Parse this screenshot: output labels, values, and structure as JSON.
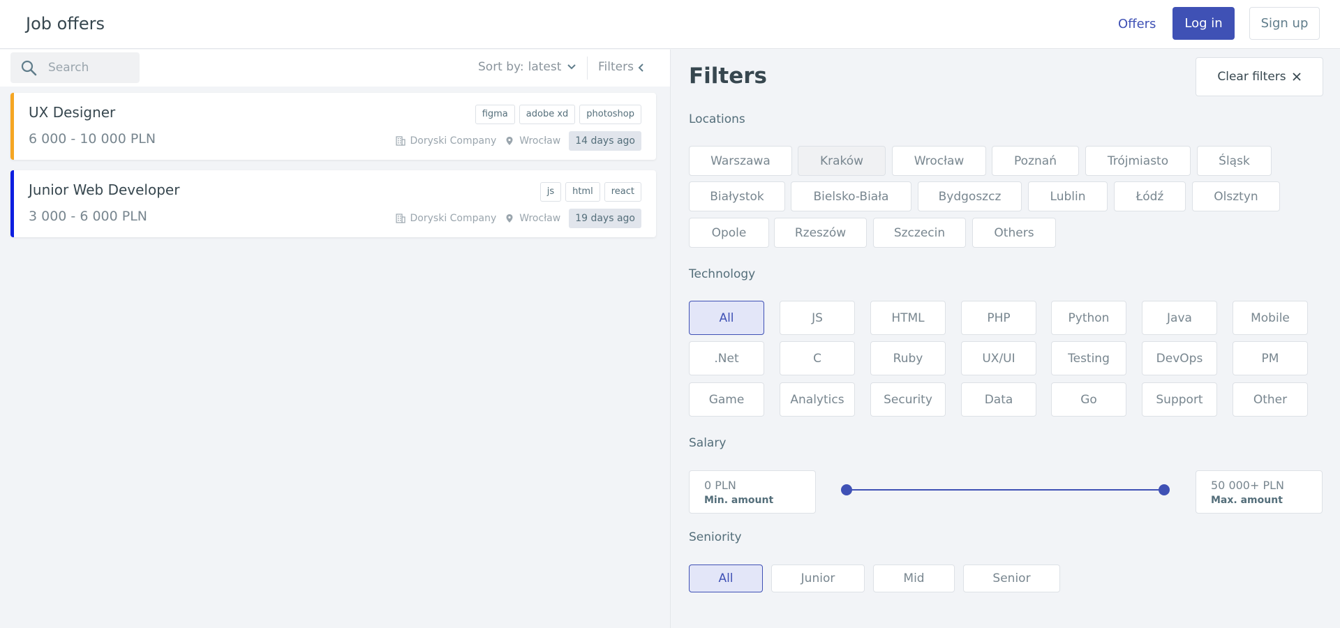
{
  "header": {
    "title": "Job offers",
    "nav_offers": "Offers",
    "login": "Log in",
    "signup": "Sign up",
    "accent": "#3f51b5"
  },
  "toolbar": {
    "search_placeholder": "Search",
    "sort_label": "Sort by:",
    "sort_value": "latest",
    "filters_label": "Filters"
  },
  "jobs": [
    {
      "title": "UX Designer",
      "salary": "6 000 - 10 000 PLN",
      "tags": [
        "figma",
        "adobe xd",
        "photoshop"
      ],
      "company": "Doryski Company",
      "city": "Wrocław",
      "age": "14 days ago",
      "accent": "#f5a623"
    },
    {
      "title": "Junior Web Developer",
      "salary": "3 000 - 6 000 PLN",
      "tags": [
        "js",
        "html",
        "react"
      ],
      "company": "Doryski Company",
      "city": "Wrocław",
      "age": "19 days ago",
      "accent": "#0d1ee0"
    }
  ],
  "filters": {
    "title": "Filters",
    "clear": "Clear filters",
    "locations_label": "Locations",
    "locations": [
      "Warszawa",
      "Kraków",
      "Wrocław",
      "Poznań",
      "Trójmiasto",
      "Śląsk",
      "Białystok",
      "Bielsko-Biała",
      "Bydgoszcz",
      "Lublin",
      "Łódź",
      "Olsztyn",
      "Opole",
      "Rzeszów",
      "Szczecin",
      "Others"
    ],
    "technology_label": "Technology",
    "technologies": [
      "All",
      "JS",
      "HTML",
      "PHP",
      "Python",
      "Java",
      "Mobile",
      ".Net",
      "C",
      "Ruby",
      "UX/UI",
      "Testing",
      "DevOps",
      "PM",
      "Game",
      "Analytics",
      "Security",
      "Data",
      "Go",
      "Support",
      "Other"
    ],
    "technology_selected": "All",
    "salary_label": "Salary",
    "salary_min": "0 PLN",
    "salary_min_label": "Min. amount",
    "salary_max": "50 000+ PLN",
    "salary_max_label": "Max. amount",
    "salary_range_fraction": [
      0,
      1
    ],
    "seniority_label": "Seniority",
    "seniority": [
      "All",
      "Junior",
      "Mid",
      "Senior"
    ],
    "seniority_selected": "All"
  }
}
